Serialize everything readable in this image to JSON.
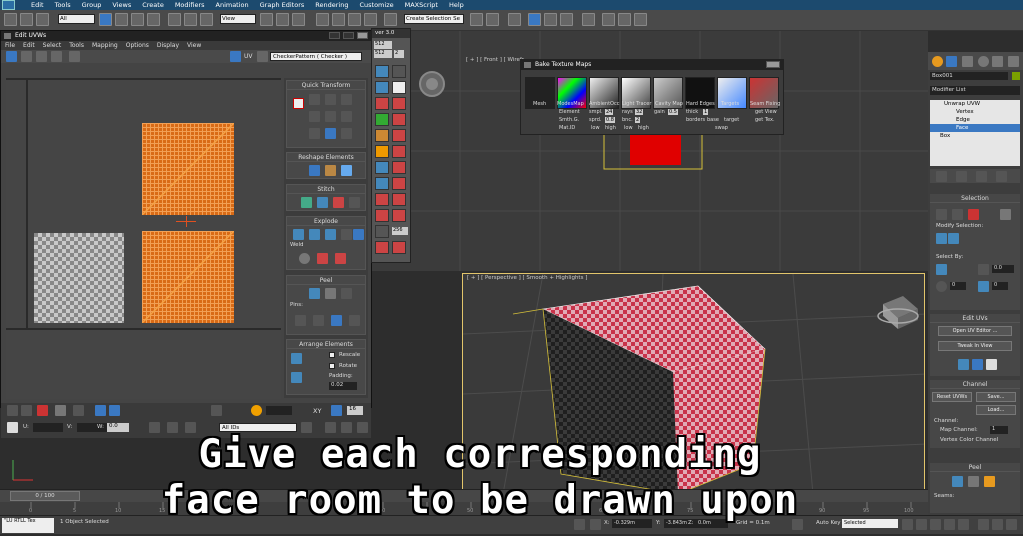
{
  "menubar": {
    "items": [
      "Edit",
      "Tools",
      "Group",
      "Views",
      "Create",
      "Modifiers",
      "Animation",
      "Graph Editors",
      "Rendering",
      "Customize",
      "MAXScript",
      "Help"
    ]
  },
  "toolbar": {
    "filter": "All",
    "view": "View",
    "selection_set": "Create Selection Se"
  },
  "uv_editor": {
    "title": "Edit UVWs",
    "menu": [
      "File",
      "Edit",
      "Select",
      "Tools",
      "Mapping",
      "Options",
      "Display",
      "View"
    ],
    "uv_label": "UV",
    "texture_dropdown": "CheckerPattern  ( Checker )",
    "sections": {
      "quick_transform": "Quick Transform",
      "reshape": "Reshape Elements",
      "stitch": "Stitch",
      "explode": "Explode",
      "weld": "Weld",
      "peel": "Peel",
      "pins": "Pins:",
      "arrange": "Arrange Elements",
      "rescale": "Rescale",
      "rotate": "Rotate",
      "padding": "Padding:",
      "padding_value": "0.02"
    },
    "bottom": {
      "u": "U:",
      "v": "V:",
      "w": "W:",
      "w_value": "0.0",
      "xy": "XY",
      "value_16": "16",
      "all_ids": "All IDs"
    }
  },
  "bake": {
    "title": "Bake Texture Maps",
    "maps": [
      "Mesh",
      "ModesMap",
      "AmbientOcc",
      "Light Tracer",
      "Cavity Map",
      "Hard Edges",
      "Targets",
      "Seam Fixing"
    ],
    "options": {
      "element": "Element",
      "smpl": "smpl.",
      "smpl_v": "24",
      "rays": "rays",
      "rays_v": "32",
      "gain": "gain",
      "gain_v": "0.5",
      "thick": "thick",
      "thick_v": "1",
      "smth": "Smth.G.",
      "sprd": "sprd.",
      "sprd_v": "0.8",
      "bnc": "bnc.",
      "bnc_v": "2",
      "borders": "borders",
      "base": "base",
      "target": "target",
      "get_view": "get View",
      "matid": "Mat.ID",
      "low1": "low",
      "high1": "high",
      "low2": "low",
      "high2": "high",
      "swap": "swap",
      "get_tex": "get Tex."
    }
  },
  "smallpanel": {
    "title": "ver 3.0",
    "val1": "512",
    "val2": "512",
    "val3": "2",
    "val4": "256"
  },
  "viewports": {
    "front_label": "[ + ] [ Front ] [ Wirefr",
    "persp_label": "[ + ] [ Perspective ] [ Smooth + Highlights ]"
  },
  "command_panel": {
    "object_name": "Box001",
    "modifier_list": "Modifier List",
    "stack": [
      "Unwrap UVW",
      "Vertex",
      "Edge",
      "Face",
      "Box"
    ],
    "selection": "Selection",
    "modify_selection": "Modify Selection:",
    "select_by": "Select By:",
    "val_a": "0.0",
    "val_b": "0",
    "val_c": "0",
    "edit_uvs": "Edit UVs",
    "open_uv_editor": "Open UV Editor ...",
    "tweak_in_view": "Tweak In View",
    "channel": "Channel",
    "reset_uvws": "Reset UVWs",
    "save": "Save...",
    "load": "Load...",
    "channel_label": "Channel:",
    "map_channel": "Map Channel:",
    "map_channel_value": "1",
    "vertex_color_channel": "Vertex Color Channel",
    "peel": "Peel",
    "seams": "Seams:"
  },
  "timeline": {
    "position": "0 / 100",
    "ticks": [
      "0",
      "5",
      "10",
      "15",
      "20",
      "25",
      "30",
      "35",
      "40",
      "45",
      "50",
      "55",
      "60",
      "65",
      "70",
      "75",
      "80",
      "85",
      "90",
      "95",
      "100"
    ]
  },
  "status": {
    "objects_selected": "1 Object Selected",
    "maxscript": "\"LU RTLL Tex",
    "x_label": "X:",
    "x_value": "-0.329m",
    "y_label": "Y:",
    "y_value": "-3.843m",
    "z_label": "Z:",
    "z_value": "0.0m",
    "grid": "Grid = 0.1m",
    "auto_key": "Auto Key",
    "selected": "Selected"
  },
  "caption": {
    "line1": "Give each corresponding",
    "line2": "face room to be drawn upon"
  }
}
